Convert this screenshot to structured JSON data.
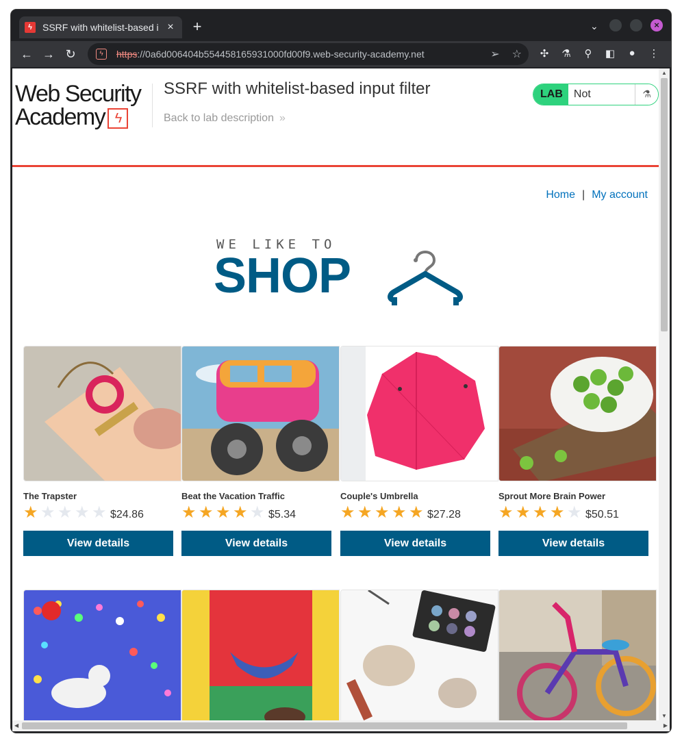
{
  "browser": {
    "tab_title": "SSRF with whitelist-based input filter",
    "tab_close": "×",
    "new_tab": "+",
    "url_scheme": "https",
    "url_rest": "://0a6d006404b554458165931000fd00f9.web-security-academy.net"
  },
  "lab": {
    "logo_line1": "Web Security",
    "logo_line2": "Academy",
    "title": "SSRF with whitelist-based input filter",
    "back_link": "Back to lab description",
    "badge": "LAB",
    "status": "Not solved"
  },
  "nav": {
    "home": "Home",
    "separator": "|",
    "account": "My account"
  },
  "banner": {
    "small": "WE LIKE TO",
    "big": "SHOP"
  },
  "products": [
    {
      "name": "The Trapster",
      "rating": 1,
      "price": "$24.86",
      "button": "View details"
    },
    {
      "name": "Beat the Vacation Traffic",
      "rating": 4,
      "price": "$5.34",
      "button": "View details"
    },
    {
      "name": "Couple's Umbrella",
      "rating": 5,
      "price": "$27.28",
      "button": "View details"
    },
    {
      "name": "Sprout More Brain Power",
      "rating": 4,
      "price": "$50.51",
      "button": "View details"
    }
  ],
  "colors": {
    "accent": "#005b85",
    "link": "#0071bc",
    "lab_green": "#2ed27d",
    "header_rule": "#ea4335",
    "star": "#f5a623"
  }
}
